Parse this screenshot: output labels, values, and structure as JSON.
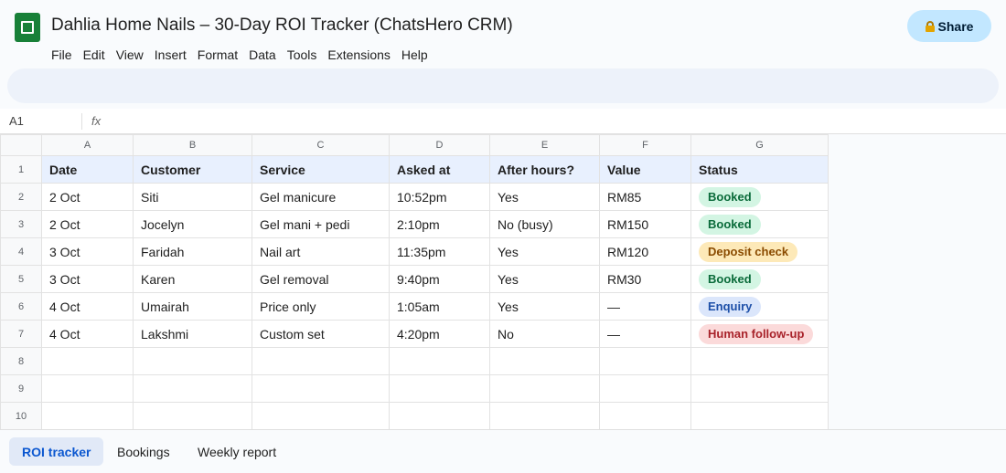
{
  "app": {
    "title": "Dahlia Home Nails – 30-Day ROI Tracker (ChatsHero CRM)",
    "share_label": "Share",
    "menu": [
      "File",
      "Edit",
      "View",
      "Insert",
      "Format",
      "Data",
      "Tools",
      "Extensions",
      "Help"
    ]
  },
  "formula": {
    "cell_ref": "A1",
    "fx": "fx",
    "value": ""
  },
  "sheet": {
    "columns": [
      "A",
      "B",
      "C",
      "D",
      "E",
      "F",
      "G"
    ],
    "row_numbers": [
      "1",
      "2",
      "3",
      "4",
      "5",
      "6",
      "7",
      "8",
      "9",
      "10"
    ],
    "headers": [
      "Date",
      "Customer",
      "Service",
      "Asked at",
      "After hours?",
      "Value",
      "Status"
    ],
    "rows": [
      {
        "date": "2 Oct",
        "customer": "Siti",
        "service": "Gel manicure",
        "asked_at": "10:52pm",
        "after_hours": "Yes",
        "value": "RM85",
        "status": "Booked",
        "status_kind": "booked"
      },
      {
        "date": "2 Oct",
        "customer": "Jocelyn",
        "service": "Gel mani + pedi",
        "asked_at": "2:10pm",
        "after_hours": "No (busy)",
        "value": "RM150",
        "status": "Booked",
        "status_kind": "booked"
      },
      {
        "date": "3 Oct",
        "customer": "Faridah",
        "service": "Nail art",
        "asked_at": "11:35pm",
        "after_hours": "Yes",
        "value": "RM120",
        "status": "Deposit check",
        "status_kind": "deposit"
      },
      {
        "date": "3 Oct",
        "customer": "Karen",
        "service": "Gel removal",
        "asked_at": "9:40pm",
        "after_hours": "Yes",
        "value": "RM30",
        "status": "Booked",
        "status_kind": "booked"
      },
      {
        "date": "4 Oct",
        "customer": "Umairah",
        "service": "Price only",
        "asked_at": "1:05am",
        "after_hours": "Yes",
        "value": "—",
        "status": "Enquiry",
        "status_kind": "enquiry"
      },
      {
        "date": "4 Oct",
        "customer": "Lakshmi",
        "service": "Custom set",
        "asked_at": "4:20pm",
        "after_hours": "No",
        "value": "—",
        "status": "Human follow-up",
        "status_kind": "followup"
      }
    ],
    "empty_rows": 3
  },
  "status_colors": {
    "booked": {
      "bg": "#d3f5e3",
      "fg": "#0a6b3a"
    },
    "deposit": {
      "bg": "#fde9b8",
      "fg": "#8a4b00"
    },
    "enquiry": {
      "bg": "#dbe6fb",
      "fg": "#1d4fa8"
    },
    "followup": {
      "bg": "#fbdada",
      "fg": "#a8222a"
    }
  },
  "tabs": [
    {
      "label": "ROI tracker",
      "active": true
    },
    {
      "label": "Bookings",
      "active": false
    },
    {
      "label": "Weekly report",
      "active": false
    }
  ]
}
